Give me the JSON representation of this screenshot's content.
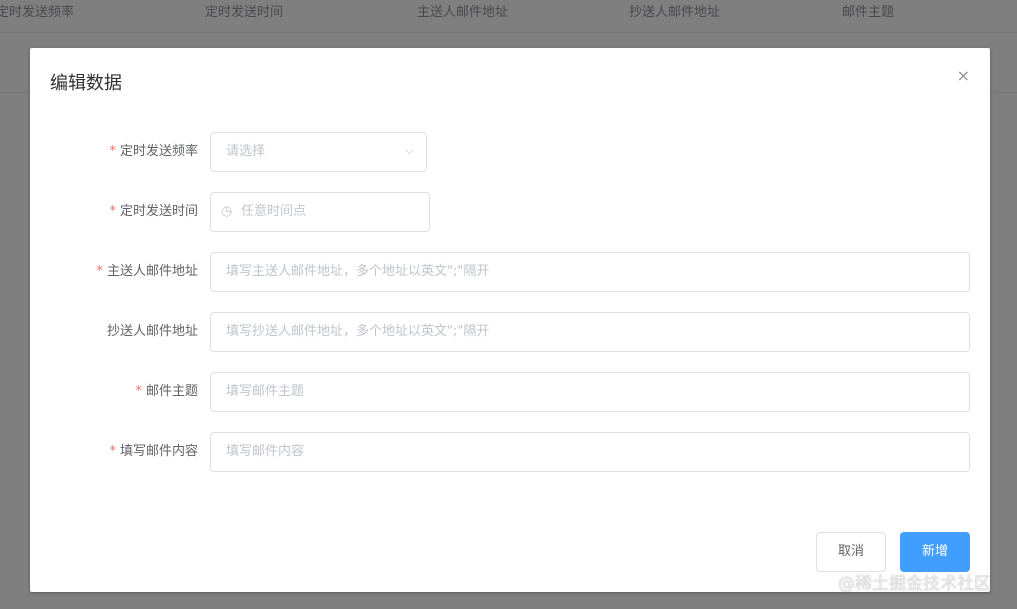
{
  "table": {
    "headers": [
      "定时发送频率",
      "定时发送时间",
      "主送人邮件地址",
      "抄送人邮件地址",
      "邮件主题"
    ]
  },
  "dialog": {
    "title": "编辑数据",
    "close": "×",
    "fields": [
      {
        "label": "定时发送频率",
        "required": true,
        "placeholder": "请选择"
      },
      {
        "label": "定时发送时间",
        "required": true,
        "placeholder": "任意时间点"
      },
      {
        "label": "主送人邮件地址",
        "required": true,
        "placeholder": "填写主送人邮件地址，多个地址以英文\";\"隔开"
      },
      {
        "label": "抄送人邮件地址",
        "required": false,
        "placeholder": "填写抄送人邮件地址，多个地址以英文\";\"隔开"
      },
      {
        "label": "邮件主题",
        "required": true,
        "placeholder": "填写邮件主题"
      },
      {
        "label": "填写邮件内容",
        "required": true,
        "placeholder": "填写邮件内容"
      }
    ],
    "cancel": "取消",
    "submit": "新增"
  },
  "watermark": "@稀土掘金技术社区",
  "star": "*"
}
